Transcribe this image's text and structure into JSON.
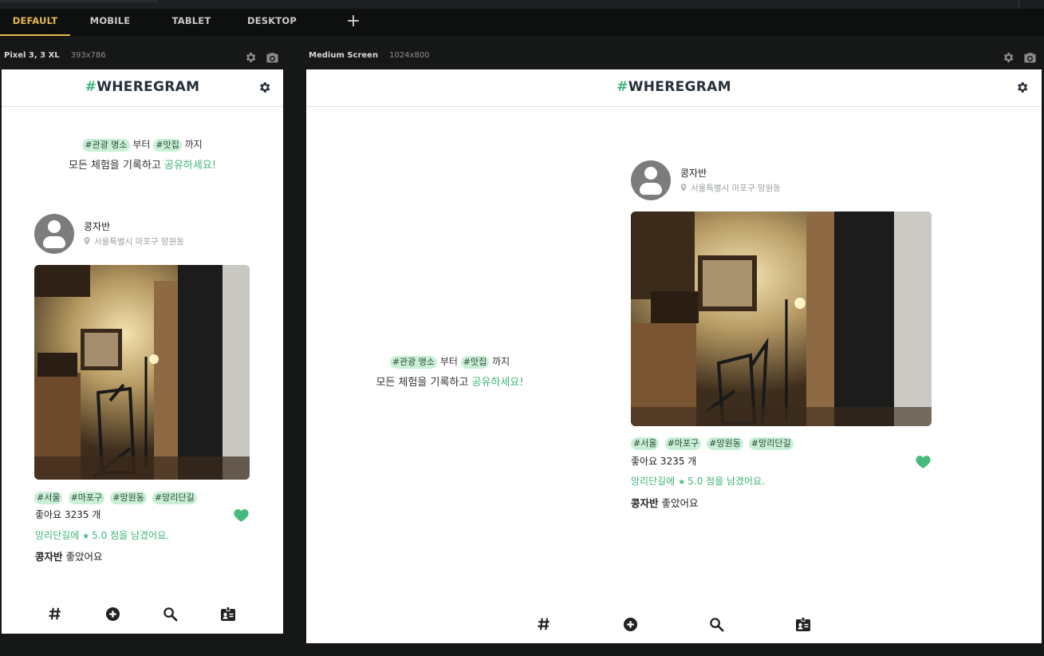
{
  "tabs": [
    {
      "label": "DEFAULT",
      "active": true
    },
    {
      "label": "MOBILE",
      "active": false
    },
    {
      "label": "TABLET",
      "active": false
    },
    {
      "label": "DESKTOP",
      "active": false
    }
  ],
  "add_tab_icon": "plus-icon",
  "devices": {
    "mobile": {
      "name": "Pixel 3, 3 XL",
      "dims": "393x786"
    },
    "desktop": {
      "name": "Medium Screen",
      "dims": "1024x800"
    }
  },
  "app": {
    "logo_hash": "#",
    "logo_text": "WHEREGRAM",
    "accent_color": "#3fb57a",
    "settings_icon": "gear-icon"
  },
  "hero": {
    "tag1": "#관광 명소",
    "from": "부터",
    "tag2": "#맛집",
    "until": "까지",
    "line2_a": "모든",
    "line2_b": "체험을 기록하고",
    "line2_c": "공유하세요!"
  },
  "post": {
    "author": "콩자반",
    "location": "서울특별시 마포구 망원동",
    "photo_alt": "cafe interior with chairs and lamp",
    "tags": [
      "#서울",
      "#마포구",
      "#망원동",
      "#망리단길"
    ],
    "likes_text": "좋아요 3235 개",
    "review_place": "망리단길에",
    "review_score": "5.0 점을 남겼어요.",
    "liked_name": "콩자반",
    "liked_suffix": "좋았어요"
  },
  "bottom_nav": [
    {
      "name": "hashtag-icon"
    },
    {
      "name": "add-circle-icon"
    },
    {
      "name": "search-icon"
    },
    {
      "name": "profile-card-icon"
    }
  ]
}
